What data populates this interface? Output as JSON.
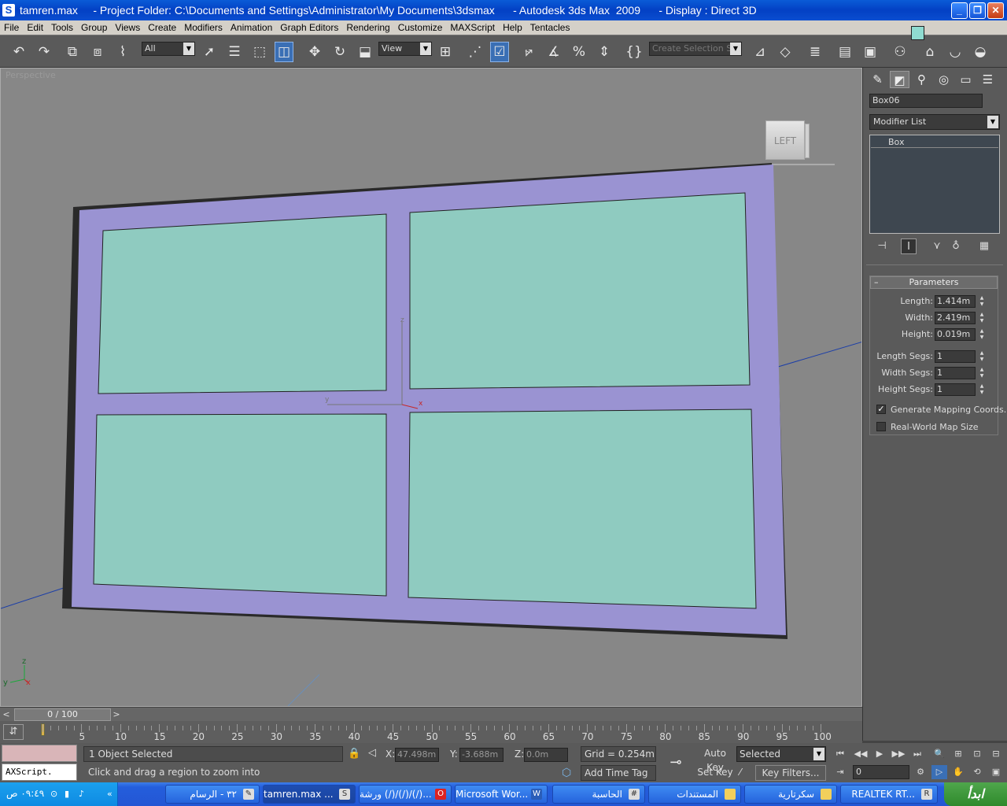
{
  "window": {
    "title": "tamren.max     - Project Folder: C:\\Documents and Settings\\Administrator\\My Documents\\3dsmax      - Autodesk 3ds Max  2009      - Display : Direct 3D",
    "app_icon": "3ds-max-icon"
  },
  "menu": [
    "File",
    "Edit",
    "Tools",
    "Group",
    "Views",
    "Create",
    "Modifiers",
    "Animation",
    "Graph Editors",
    "Rendering",
    "Customize",
    "MAXScript",
    "Help",
    "Tentacles"
  ],
  "toolbar": {
    "filter_value": "All",
    "refcoord_value": "View",
    "selection_set_placeholder": "Create Selection Set"
  },
  "viewport": {
    "label": "Perspective",
    "viewcube_label": "LEFT",
    "gizmo_labels": {
      "x": "x",
      "y": "y",
      "z": "z"
    },
    "corner_axis": {
      "x": "x",
      "y": "y",
      "z": "z"
    },
    "colors": {
      "background": "#878787",
      "frame": "#9a93d2",
      "glass": "#8fcbc0",
      "edge": "#2a2a2a"
    }
  },
  "command_panel": {
    "object_name": "Box06",
    "object_color": "#8fdcd0",
    "modifier_list": "Modifier List",
    "stack_item": "Box",
    "parameters_title": "Parameters",
    "params": [
      {
        "label": "Length:",
        "value": "1.414m"
      },
      {
        "label": "Width:",
        "value": "2.419m"
      },
      {
        "label": "Height:",
        "value": "0.019m"
      }
    ],
    "segs": [
      {
        "label": "Length Segs:",
        "value": "1"
      },
      {
        "label": "Width Segs:",
        "value": "1"
      },
      {
        "label": "Height Segs:",
        "value": "1"
      }
    ],
    "gen_mapping": "Generate Mapping Coords.",
    "real_world": "Real-World Map Size",
    "gen_mapping_checked": true,
    "real_world_checked": false
  },
  "timeline": {
    "slider_label": "0 / 100",
    "current_frame": 0,
    "ticks": [
      5,
      10,
      15,
      20,
      25,
      30,
      35,
      40,
      45,
      50,
      55,
      60,
      65,
      70,
      75,
      80,
      85,
      90,
      95,
      100
    ]
  },
  "status": {
    "selection": "1 Object Selected",
    "prompt": "Click and drag a region to zoom into",
    "listener_text": "AXScript.",
    "x_label": "X:",
    "x_value": "47.498m",
    "y_label": "Y:",
    "y_value": "-3.688m",
    "z_label": "Z:",
    "z_value": "0.0m",
    "grid": "Grid = 0.254m",
    "add_time_tag": "Add Time Tag",
    "auto_key": "Auto Key",
    "set_key": "Set Key",
    "selected": "Selected",
    "key_filters": "Key Filters...",
    "frame": "0"
  },
  "taskbar": {
    "start": "ابدأ",
    "clock": "٠٩:٤٩ ص",
    "tasks": [
      {
        "label": "REALTEK RT...",
        "icon": "realtek-icon"
      },
      {
        "label": "سكرتارية",
        "icon": "folder-icon"
      },
      {
        "label": "المستندات",
        "icon": "folder-icon"
      },
      {
        "label": "الحاسبة",
        "icon": "calculator-icon"
      },
      {
        "label": "Microsoft Wor...",
        "icon": "word-icon"
      },
      {
        "label": "ورشة (/)/(/)/(/)...",
        "icon": "opera-icon"
      },
      {
        "label": "tamren.max ...",
        "icon": "3ds-max-icon"
      },
      {
        "label": "٣٢ - الرسام",
        "icon": "paint-icon"
      }
    ]
  }
}
